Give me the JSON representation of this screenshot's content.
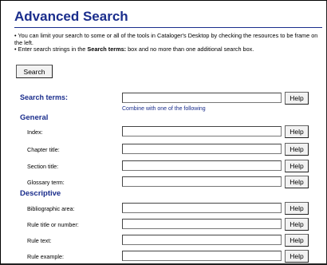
{
  "page": {
    "title": "Advanced Search"
  },
  "instructions": {
    "line1": "You can limit your search to some or all of the tools in Cataloger's Desktop by checking the resources to be frame on the left.",
    "line2_pre": "Enter search strings in the",
    "line2_bold": "Search terms:",
    "line2_post": "box and no more than one additional search box."
  },
  "search_button": "Search",
  "search_terms": {
    "label": "Search terms:",
    "value": "",
    "help": "Help",
    "hint": "Combine with one of the following"
  },
  "general": {
    "heading": "General",
    "fields": [
      {
        "label": "Index:",
        "value": "",
        "help": "Help"
      },
      {
        "label": "Chapter title:",
        "value": "",
        "help": "Help"
      },
      {
        "label": "Section title:",
        "value": "",
        "help": "Help"
      },
      {
        "label": "Glossary term:",
        "value": "",
        "help": "Help"
      }
    ]
  },
  "descriptive": {
    "heading": "Descriptive",
    "fields": [
      {
        "label": "Bibliographic area:",
        "value": "",
        "help": "Help"
      },
      {
        "label": "Rule title or number:",
        "value": "",
        "help": "Help"
      },
      {
        "label": "Rule text:",
        "value": "",
        "help": "Help"
      },
      {
        "label": "Rule example:",
        "value": "",
        "help": "Help"
      }
    ]
  },
  "colors": {
    "heading": "#1a2d8c",
    "text": "#000000",
    "button_face": "#f2f2f2"
  }
}
